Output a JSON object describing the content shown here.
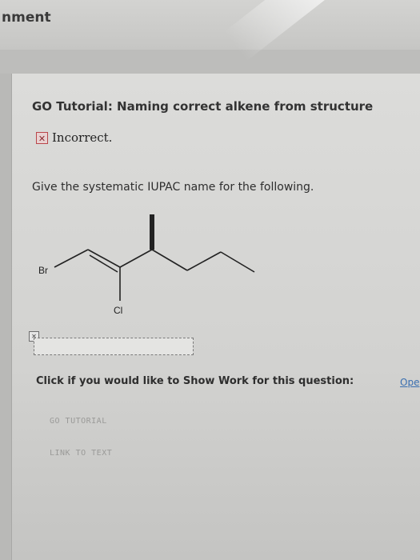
{
  "header": {
    "title_fragment": "nment"
  },
  "tutorial": {
    "title": "GO Tutorial: Naming correct alkene from structure",
    "status_text": "Incorrect.",
    "status_icon": "x-mark-icon"
  },
  "question": {
    "prompt": "Give the systematic IUPAC name for the following.",
    "molecule": {
      "atom_labels": {
        "br": "Br",
        "cl": "Cl"
      }
    },
    "answer": {
      "value": "",
      "placeholder": ""
    }
  },
  "show_work": {
    "prompt": "Click if you would like to Show Work for this question:",
    "link_label": "Ope"
  },
  "buttons": {
    "go_tutorial": "GO TUTORIAL",
    "link_to_text": "LINK TO TEXT"
  },
  "colors": {
    "incorrect_box": "#e9d2d2",
    "incorrect_border": "#b9464b",
    "link": "#3a6fb0"
  }
}
